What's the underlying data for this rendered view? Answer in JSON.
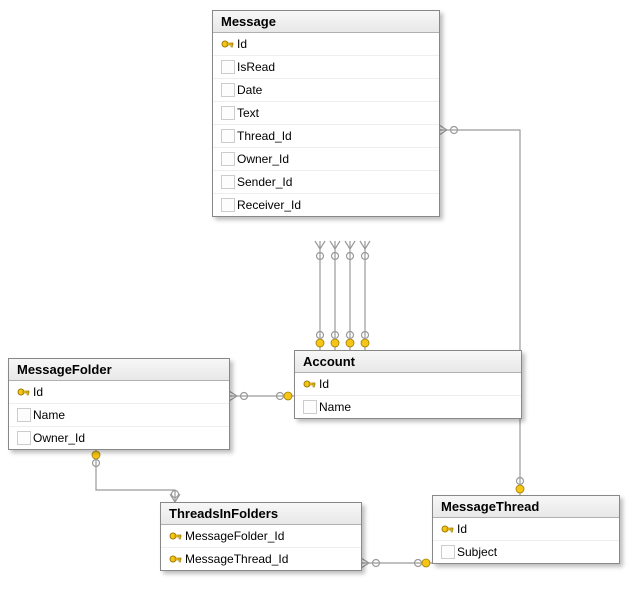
{
  "entities": {
    "message": {
      "title": "Message",
      "cols": [
        {
          "name": "Id",
          "pk": true
        },
        {
          "name": "IsRead",
          "pk": false
        },
        {
          "name": "Date",
          "pk": false
        },
        {
          "name": "Text",
          "pk": false
        },
        {
          "name": "Thread_Id",
          "pk": false
        },
        {
          "name": "Owner_Id",
          "pk": false
        },
        {
          "name": "Sender_Id",
          "pk": false
        },
        {
          "name": "Receiver_Id",
          "pk": false
        }
      ]
    },
    "messageFolder": {
      "title": "MessageFolder",
      "cols": [
        {
          "name": "Id",
          "pk": true
        },
        {
          "name": "Name",
          "pk": false
        },
        {
          "name": "Owner_Id",
          "pk": false
        }
      ]
    },
    "account": {
      "title": "Account",
      "cols": [
        {
          "name": "Id",
          "pk": true
        },
        {
          "name": "Name",
          "pk": false
        }
      ]
    },
    "threadsInFolders": {
      "title": "ThreadsInFolders",
      "cols": [
        {
          "name": "MessageFolder_Id",
          "pk": true
        },
        {
          "name": "MessageThread_Id",
          "pk": true
        }
      ]
    },
    "messageThread": {
      "title": "MessageThread",
      "cols": [
        {
          "name": "Id",
          "pk": true
        },
        {
          "name": "Subject",
          "pk": false
        }
      ]
    }
  }
}
